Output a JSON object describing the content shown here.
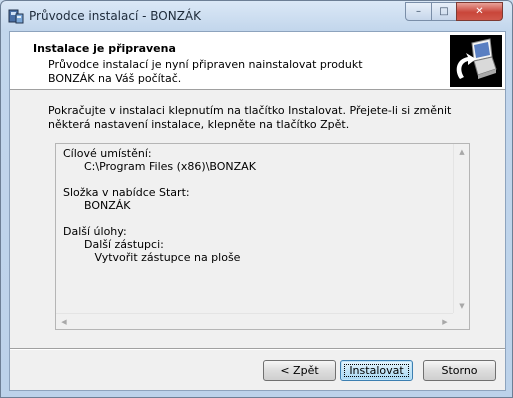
{
  "window": {
    "title": "Průvodce instalací - BONZÁK",
    "buttons": {
      "minimize": "–",
      "maximize": "□",
      "close": "✕"
    }
  },
  "header": {
    "title": "Instalace je připravena",
    "subtitle": "Průvodce instalací je nyní připraven nainstalovat produkt BONZÁK na Váš počítač."
  },
  "main": {
    "instruction": "Pokračujte v instalaci klepnutím na tlačítko Instalovat. Přejete-li si změnit některá nastavení instalace, klepněte na tlačítko Zpět."
  },
  "memo": {
    "lines": [
      "Cílové umístění:",
      "      C:\\Program Files (x86)\\BONZAK",
      "",
      "Složka v nabídce Start:",
      "      BONZÁK",
      "",
      "Další úlohy:",
      "      Další zástupci:",
      "         Vytvořit zástupce na ploše"
    ]
  },
  "buttons": {
    "back": "< Zpět",
    "install": "Instalovat",
    "cancel": "Storno"
  },
  "icons": {
    "app": "installer-icon",
    "header_image": "computer-install-icon"
  },
  "colors": {
    "client_bg": "#f0f0f0",
    "header_bg": "#ffffff",
    "close_button": "#c9463a",
    "default_button": "#a7d9f5"
  }
}
